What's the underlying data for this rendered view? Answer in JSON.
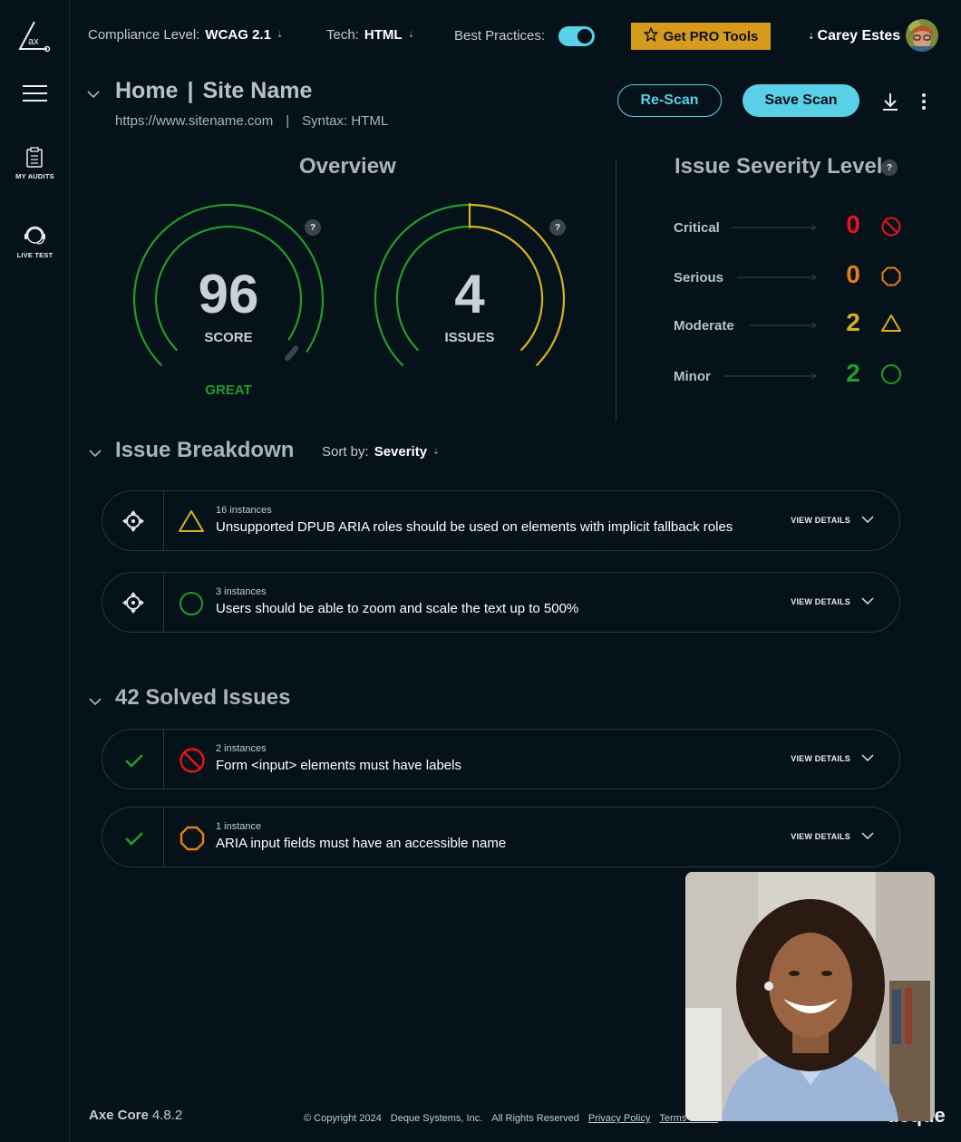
{
  "sidebar": {
    "logo_text": "ax",
    "my_audits_label": "MY AUDITS",
    "live_test_label": "LIVE TEST"
  },
  "topbar": {
    "compliance_label": "Compliance Level:",
    "compliance_value": "WCAG 2.1",
    "tech_label": "Tech:",
    "tech_value": "HTML",
    "best_practices_label": "Best Practices:",
    "best_practices_on": true,
    "pro_label": "Get PRO Tools",
    "user_name": "Carey Estes"
  },
  "header": {
    "title_home": "Home",
    "title_separator": "|",
    "title_site": "Site Name",
    "url": "https://www.sitename.com",
    "sub_separator": "|",
    "syntax": "Syntax: HTML",
    "rescan_label": "Re-Scan",
    "save_label": "Save Scan"
  },
  "overview": {
    "title": "Overview",
    "score": "96",
    "score_label": "SCORE",
    "score_rating": "GREAT",
    "score_fraction": 0.96,
    "issues": "4",
    "issues_label": "ISSUES",
    "help": "?"
  },
  "severity": {
    "title": "Issue Severity Level",
    "help": "?",
    "levels": [
      {
        "label": "Critical",
        "count": "0",
        "color": "#e8141c",
        "icon": "critical-circle-slash-icon"
      },
      {
        "label": "Serious",
        "count": "0",
        "color": "#e67e12",
        "icon": "serious-octagon-icon"
      },
      {
        "label": "Moderate",
        "count": "2",
        "color": "#d9b11c",
        "icon": "moderate-triangle-icon"
      },
      {
        "label": "Minor",
        "count": "2",
        "color": "#1f9e2a",
        "icon": "minor-circle-icon"
      }
    ]
  },
  "breakdown": {
    "title": "Issue Breakdown",
    "sort_label": "Sort by:",
    "sort_value": "Severity",
    "items": [
      {
        "instances": "16 instances",
        "title": "Unsupported DPUB ARIA roles should be used on elements with implicit fallback roles",
        "view": "VIEW DETAILS",
        "severity": "moderate"
      },
      {
        "instances": "3 instances",
        "title": "Users should be able to zoom and scale the text up to 500%",
        "view": "VIEW DETAILS",
        "severity": "minor"
      }
    ]
  },
  "solved": {
    "title": "42 Solved Issues",
    "items": [
      {
        "instances": "2 instances",
        "title": "Form <input> elements must have labels",
        "view": "VIEW DETAILS",
        "severity": "critical"
      },
      {
        "instances": "1 instance",
        "title": "ARIA input fields must have an accessible name",
        "view": "VIEW DETAILS",
        "severity": "serious"
      }
    ]
  },
  "footer": {
    "product": "Axe Core",
    "version": "4.8.2",
    "copyright": "© Copyright 2024",
    "company": "Deque Systems, Inc.",
    "rights": "All Rights Reserved",
    "privacy": "Privacy Policy",
    "terms": "Terms of Use",
    "brand": "deque"
  },
  "colors": {
    "accent": "#5ad0e8",
    "great": "#1f9e2a",
    "moderate": "#d9b11c",
    "pro": "#d69a1c"
  }
}
